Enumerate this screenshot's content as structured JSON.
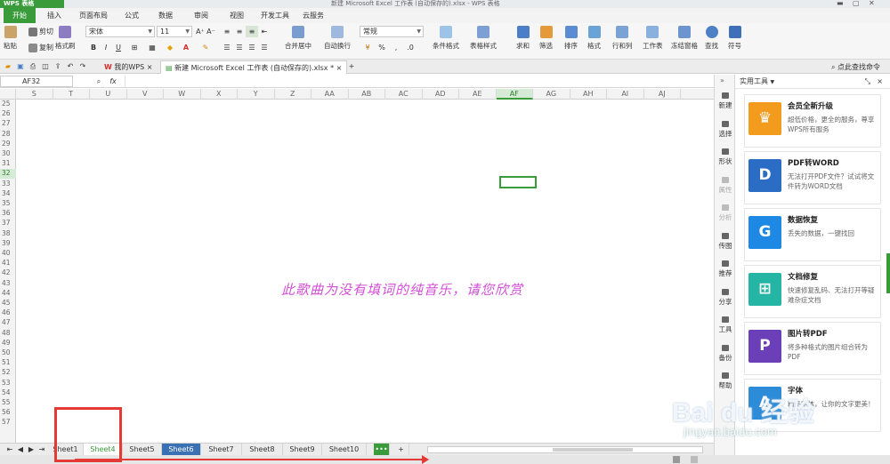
{
  "app": {
    "logo": "WPS 表格",
    "doc_title": "新建 Microsoft Excel 工作表 (自动保存的).xlsx - WPS 表格"
  },
  "ribbon_tabs": [
    "开始",
    "插入",
    "页面布局",
    "公式",
    "数据",
    "审阅",
    "视图",
    "开发工具",
    "云服务"
  ],
  "toolbar": {
    "paste": "粘贴",
    "cut": "剪切",
    "copy": "复制",
    "format_painter": "格式刷",
    "font_name": "宋体",
    "font_size": "11",
    "merge_center": "合并居中",
    "wrap_text": "自动换行",
    "number_format": "常规",
    "percent": "%",
    "cond_format": "条件格式",
    "table_style": "表格样式",
    "sum": "求和",
    "filter": "筛选",
    "sort": "排序",
    "format": "格式",
    "rows_cols": "行和列",
    "worksheet": "工作表",
    "freeze": "冻结窗格",
    "find": "查找",
    "symbol": "符号"
  },
  "doc_tabs": {
    "home": "我的WPS",
    "active": "新建 Microsoft Excel 工作表 (自动保存的).xlsx *",
    "right_link": "点此查找命令"
  },
  "formula_bar": {
    "name_box": "AF32",
    "fx": "fx"
  },
  "columns": [
    "S",
    "T",
    "U",
    "V",
    "W",
    "X",
    "Y",
    "Z",
    "AA",
    "AB",
    "AC",
    "AD",
    "AE",
    "AF",
    "AG",
    "AH",
    "AI",
    "AJ"
  ],
  "selected_column": "AF",
  "rows": [
    "25",
    "26",
    "27",
    "28",
    "29",
    "30",
    "31",
    "32",
    "33",
    "34",
    "35",
    "36",
    "37",
    "38",
    "39",
    "40",
    "41",
    "42",
    "43",
    "44",
    "45",
    "46",
    "47",
    "48",
    "49",
    "50",
    "51",
    "52",
    "53",
    "54",
    "55",
    "56",
    "57"
  ],
  "selected_row": "32",
  "cell_text": "此歌曲为没有填词的纯音乐，请您欣赏",
  "sheets": [
    "Sheet1",
    "Sheet4",
    "Sheet5",
    "Sheet6",
    "Sheet7",
    "Sheet8",
    "Sheet9",
    "Sheet10"
  ],
  "active_sheet": "Sheet4",
  "add_sheet": "+",
  "right_strip": [
    "新建",
    "选择",
    "形状",
    "属性",
    "分析",
    "传图",
    "推荐",
    "分享",
    "工具",
    "备份",
    "帮助"
  ],
  "panel": {
    "title": "实用工具",
    "cards": [
      {
        "title": "会员全新升级",
        "desc": "超低价格，更全的服务，尊享WPS所有服务",
        "color": "#f29b1d",
        "icon": "crown-icon"
      },
      {
        "title": "PDF转WORD",
        "desc": "无法打开PDF文件？试试将文件转为WORD文档",
        "color": "#2b6cc4",
        "icon": "pdf-icon"
      },
      {
        "title": "数据恢复",
        "desc": "丢失的数据，一键找回",
        "color": "#1e88e5",
        "icon": "recover-icon"
      },
      {
        "title": "文档修复",
        "desc": "快速修复乱码、无法打开等疑难杂症文档",
        "color": "#25b5a4",
        "icon": "repair-icon"
      },
      {
        "title": "图片转PDF",
        "desc": "将多种格式的图片组合转为PDF",
        "color": "#6a3fb8",
        "icon": "img-pdf-icon"
      },
      {
        "title": "字体",
        "desc": "精品字体，让你的文字更美！",
        "color": "#2d8cd8",
        "icon": "font-icon"
      }
    ]
  },
  "watermark": {
    "main": "Bai du 经验",
    "sub": "jingyan.baidu.com"
  }
}
